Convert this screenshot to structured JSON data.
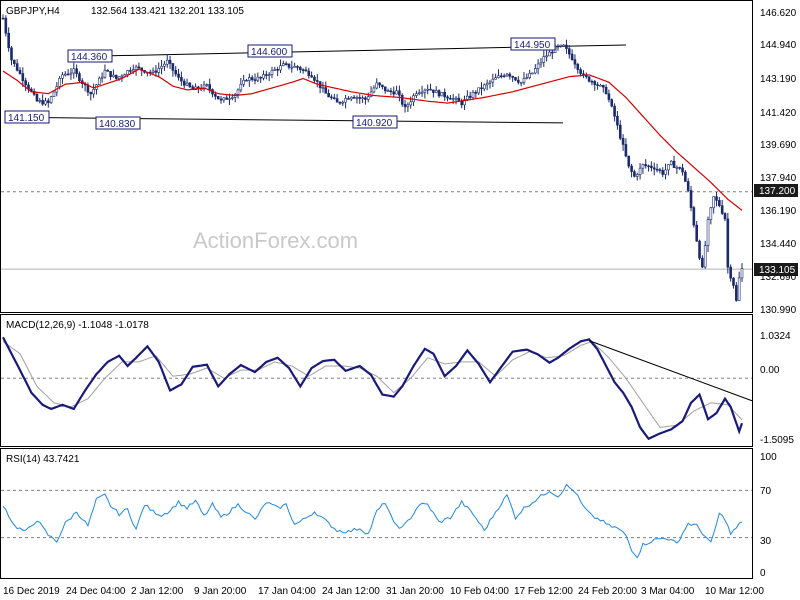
{
  "chart_data": {
    "type": "candlestick",
    "symbol_header": "GBPJPY,H4",
    "ohlc_header": "132.564 133.421 132.201 133.105",
    "watermark": "ActionForex.com",
    "colors": {
      "candle": "#1a2a6c",
      "ma": "#d60000",
      "macd": "#1a1a7a",
      "signal": "#a0a0a0",
      "rsi": "#1e88e5",
      "grid": "#808080",
      "axis": "#000000",
      "annot_fill": "#ffffff"
    },
    "x_ticks": [
      "16 Dec 2019",
      "24 Dec 04:00",
      "2 Jan 12:00",
      "9 Jan 20:00",
      "17 Jan 04:00",
      "24 Jan 12:00",
      "31 Jan 20:00",
      "10 Feb 04:00",
      "17 Feb 12:00",
      "24 Feb 20:00",
      "3 Mar 04:00",
      "10 Mar 12:00"
    ],
    "price_panel": {
      "ylim": [
        130.99,
        146.62
      ],
      "y_ticks": [
        "146.620",
        "144.940",
        "143.190",
        "141.420",
        "139.690",
        "137.940",
        "136.190",
        "134.440",
        "132.690",
        "130.990"
      ],
      "current_price": "133.105",
      "level_line": "137.200",
      "annotations": [
        "144.360",
        "144.600",
        "144.950",
        "141.150",
        "140.830",
        "140.920"
      ],
      "ma_anchor": [
        [
          0,
          143.6
        ],
        [
          5,
          143.1
        ],
        [
          10,
          142.5
        ],
        [
          16,
          142.4
        ],
        [
          22,
          142.9
        ],
        [
          28,
          143.0
        ],
        [
          32,
          142.7
        ],
        [
          36,
          142.9
        ],
        [
          42,
          143.2
        ],
        [
          48,
          143.7
        ],
        [
          55,
          143.3
        ],
        [
          60,
          142.8
        ],
        [
          65,
          142.6
        ],
        [
          71,
          142.7
        ],
        [
          76,
          142.4
        ],
        [
          82,
          142.3
        ],
        [
          88,
          142.4
        ],
        [
          95,
          142.7
        ],
        [
          102,
          143.0
        ],
        [
          106,
          143.2
        ],
        [
          111,
          142.9
        ],
        [
          117,
          142.7
        ],
        [
          123,
          142.5
        ],
        [
          131,
          142.3
        ],
        [
          140,
          142.2
        ],
        [
          150,
          142.0
        ],
        [
          157,
          141.9
        ],
        [
          170,
          142.2
        ],
        [
          180,
          142.5
        ],
        [
          190,
          142.9
        ],
        [
          200,
          143.3
        ],
        [
          207,
          143.4
        ],
        [
          214,
          143.0
        ],
        [
          220,
          142.2
        ],
        [
          226,
          141.2
        ],
        [
          232,
          140.2
        ],
        [
          238,
          139.3
        ],
        [
          244,
          138.5
        ],
        [
          250,
          137.7
        ],
        [
          256,
          136.8
        ],
        [
          262,
          136.1
        ]
      ],
      "close_anchor": [
        [
          0,
          146.4
        ],
        [
          3,
          144.2
        ],
        [
          7,
          143.2
        ],
        [
          12,
          142.0
        ],
        [
          16,
          141.9
        ],
        [
          21,
          143.4
        ],
        [
          25,
          143.6
        ],
        [
          31,
          142.4
        ],
        [
          36,
          143.6
        ],
        [
          40,
          143.2
        ],
        [
          46,
          143.8
        ],
        [
          53,
          143.5
        ],
        [
          58,
          144.1
        ],
        [
          62,
          143.2
        ],
        [
          67,
          142.6
        ],
        [
          72,
          142.8
        ],
        [
          77,
          142.0
        ],
        [
          82,
          142.4
        ],
        [
          86,
          143.2
        ],
        [
          91,
          143.2
        ],
        [
          94,
          143.5
        ],
        [
          99,
          143.9
        ],
        [
          104,
          143.8
        ],
        [
          109,
          143.4
        ],
        [
          114,
          142.4
        ],
        [
          118,
          141.9
        ],
        [
          123,
          142.3
        ],
        [
          128,
          142.1
        ],
        [
          132,
          142.9
        ],
        [
          136,
          142.5
        ],
        [
          139,
          142.5
        ],
        [
          142,
          141.6
        ],
        [
          146,
          142.5
        ],
        [
          150,
          142.7
        ],
        [
          154,
          142.4
        ],
        [
          158,
          142.2
        ],
        [
          162,
          141.9
        ],
        [
          166,
          142.4
        ],
        [
          170,
          142.8
        ],
        [
          174,
          143.2
        ],
        [
          178,
          143.5
        ],
        [
          183,
          143.0
        ],
        [
          187,
          143.5
        ],
        [
          191,
          144.3
        ],
        [
          195,
          144.8
        ],
        [
          198,
          144.9
        ],
        [
          201,
          144.3
        ],
        [
          205,
          143.3
        ],
        [
          209,
          143.0
        ],
        [
          213,
          142.5
        ],
        [
          216,
          141.2
        ],
        [
          219,
          139.6
        ],
        [
          221,
          138.5
        ],
        [
          223,
          138.0
        ],
        [
          226,
          138.6
        ],
        [
          230,
          138.5
        ],
        [
          233,
          138.2
        ],
        [
          236,
          138.7
        ],
        [
          240,
          138.3
        ],
        [
          242,
          137.2
        ],
        [
          244,
          135.5
        ],
        [
          246,
          133.8
        ],
        [
          247,
          133.1
        ],
        [
          249,
          135.6
        ],
        [
          251,
          136.9
        ],
        [
          253,
          136.5
        ],
        [
          255,
          135.8
        ],
        [
          256,
          133.2
        ],
        [
          258,
          132.3
        ],
        [
          259,
          131.4
        ],
        [
          260,
          132.6
        ],
        [
          261,
          133.1
        ]
      ]
    },
    "macd_panel": {
      "label": "MACD(12,26,9) -1.1048 -1.0178",
      "ylim": [
        -1.5095,
        1.0324
      ],
      "y_ticks": [
        "1.0324",
        "0.00",
        "-1.5095"
      ],
      "main_anchor": [
        [
          0,
          1.0
        ],
        [
          6,
          0.2
        ],
        [
          10,
          -0.35
        ],
        [
          14,
          -0.65
        ],
        [
          17,
          -0.75
        ],
        [
          21,
          -0.65
        ],
        [
          25,
          -0.75
        ],
        [
          29,
          -0.3
        ],
        [
          33,
          0.1
        ],
        [
          37,
          0.4
        ],
        [
          41,
          0.55
        ],
        [
          44,
          0.3
        ],
        [
          47,
          0.5
        ],
        [
          51,
          0.78
        ],
        [
          55,
          0.4
        ],
        [
          59,
          -0.3
        ],
        [
          63,
          -0.15
        ],
        [
          67,
          0.28
        ],
        [
          72,
          0.33
        ],
        [
          76,
          -0.2
        ],
        [
          80,
          0.1
        ],
        [
          84,
          0.32
        ],
        [
          89,
          0.15
        ],
        [
          93,
          0.4
        ],
        [
          97,
          0.5
        ],
        [
          101,
          0.25
        ],
        [
          105,
          -0.2
        ],
        [
          109,
          0.25
        ],
        [
          113,
          0.42
        ],
        [
          117,
          0.45
        ],
        [
          121,
          0.18
        ],
        [
          126,
          0.3
        ],
        [
          130,
          0.08
        ],
        [
          134,
          -0.4
        ],
        [
          138,
          -0.45
        ],
        [
          141,
          -0.2
        ],
        [
          145,
          0.3
        ],
        [
          149,
          0.72
        ],
        [
          152,
          0.6
        ],
        [
          156,
          0.05
        ],
        [
          160,
          0.3
        ],
        [
          164,
          0.68
        ],
        [
          168,
          0.35
        ],
        [
          172,
          -0.1
        ],
        [
          176,
          0.28
        ],
        [
          180,
          0.65
        ],
        [
          185,
          0.7
        ],
        [
          189,
          0.58
        ],
        [
          193,
          0.38
        ],
        [
          196,
          0.5
        ],
        [
          200,
          0.72
        ],
        [
          204,
          0.9
        ],
        [
          207,
          0.95
        ],
        [
          210,
          0.7
        ],
        [
          213,
          0.3
        ],
        [
          216,
          -0.1
        ],
        [
          219,
          -0.35
        ],
        [
          222,
          -0.7
        ],
        [
          225,
          -1.2
        ],
        [
          228,
          -1.48
        ],
        [
          232,
          -1.35
        ],
        [
          236,
          -1.25
        ],
        [
          240,
          -1.05
        ],
        [
          243,
          -0.6
        ],
        [
          246,
          -0.4
        ],
        [
          249,
          -1.0
        ],
        [
          252,
          -0.85
        ],
        [
          255,
          -0.5
        ],
        [
          257,
          -0.7
        ],
        [
          259,
          -1.1
        ],
        [
          260,
          -1.3
        ],
        [
          261,
          -1.1
        ]
      ],
      "signal_anchor": [
        [
          0,
          0.9
        ],
        [
          6,
          0.6
        ],
        [
          12,
          -0.2
        ],
        [
          18,
          -0.6
        ],
        [
          24,
          -0.7
        ],
        [
          30,
          -0.5
        ],
        [
          36,
          0.0
        ],
        [
          42,
          0.4
        ],
        [
          48,
          0.4
        ],
        [
          54,
          0.55
        ],
        [
          60,
          0.05
        ],
        [
          66,
          0.1
        ],
        [
          72,
          0.25
        ],
        [
          78,
          0.0
        ],
        [
          84,
          0.2
        ],
        [
          90,
          0.2
        ],
        [
          96,
          0.4
        ],
        [
          102,
          0.3
        ],
        [
          108,
          0.05
        ],
        [
          114,
          0.3
        ],
        [
          120,
          0.3
        ],
        [
          126,
          0.25
        ],
        [
          132,
          0.05
        ],
        [
          138,
          -0.35
        ],
        [
          144,
          0.0
        ],
        [
          150,
          0.5
        ],
        [
          156,
          0.35
        ],
        [
          162,
          0.4
        ],
        [
          168,
          0.4
        ],
        [
          174,
          0.05
        ],
        [
          180,
          0.45
        ],
        [
          186,
          0.65
        ],
        [
          192,
          0.5
        ],
        [
          198,
          0.55
        ],
        [
          204,
          0.8
        ],
        [
          208,
          0.9
        ],
        [
          214,
          0.5
        ],
        [
          220,
          0.0
        ],
        [
          226,
          -0.6
        ],
        [
          232,
          -1.2
        ],
        [
          238,
          -1.15
        ],
        [
          244,
          -0.8
        ],
        [
          250,
          -0.6
        ],
        [
          256,
          -0.65
        ],
        [
          261,
          -1.02
        ]
      ],
      "trendline": "from 0.92 at 17 Feb peak to -0.55 at right edge"
    },
    "rsi_panel": {
      "label": "RSI(14) 43.7421",
      "ylim": [
        0,
        100
      ],
      "y_ticks": [
        "100",
        "70",
        "30",
        "0"
      ],
      "anchor": [
        [
          0,
          58
        ],
        [
          4,
          40
        ],
        [
          8,
          35
        ],
        [
          12,
          45
        ],
        [
          16,
          32
        ],
        [
          19,
          27
        ],
        [
          22,
          42
        ],
        [
          26,
          52
        ],
        [
          30,
          40
        ],
        [
          33,
          62
        ],
        [
          36,
          66
        ],
        [
          38,
          57
        ],
        [
          41,
          50
        ],
        [
          44,
          54
        ],
        [
          47,
          37
        ],
        [
          50,
          58
        ],
        [
          53,
          52
        ],
        [
          56,
          49
        ],
        [
          59,
          53
        ],
        [
          62,
          60
        ],
        [
          65,
          55
        ],
        [
          68,
          61
        ],
        [
          71,
          48
        ],
        [
          74,
          58
        ],
        [
          77,
          47
        ],
        [
          80,
          52
        ],
        [
          83,
          58
        ],
        [
          86,
          52
        ],
        [
          89,
          45
        ],
        [
          93,
          60
        ],
        [
          97,
          55
        ],
        [
          100,
          58
        ],
        [
          103,
          41
        ],
        [
          106,
          45
        ],
        [
          110,
          52
        ],
        [
          114,
          44
        ],
        [
          118,
          36
        ],
        [
          122,
          35
        ],
        [
          126,
          38
        ],
        [
          129,
          33
        ],
        [
          132,
          52
        ],
        [
          135,
          60
        ],
        [
          138,
          42
        ],
        [
          141,
          38
        ],
        [
          144,
          47
        ],
        [
          147,
          58
        ],
        [
          150,
          58
        ],
        [
          154,
          43
        ],
        [
          158,
          47
        ],
        [
          162,
          60
        ],
        [
          166,
          50
        ],
        [
          170,
          36
        ],
        [
          174,
          52
        ],
        [
          178,
          66
        ],
        [
          181,
          47
        ],
        [
          184,
          55
        ],
        [
          187,
          60
        ],
        [
          190,
          65
        ],
        [
          193,
          70
        ],
        [
          196,
          65
        ],
        [
          199,
          74
        ],
        [
          202,
          69
        ],
        [
          205,
          56
        ],
        [
          208,
          48
        ],
        [
          211,
          45
        ],
        [
          214,
          40
        ],
        [
          217,
          38
        ],
        [
          220,
          32
        ],
        [
          222,
          20
        ],
        [
          224,
          14
        ],
        [
          226,
          24
        ],
        [
          230,
          28
        ],
        [
          234,
          30
        ],
        [
          238,
          25
        ],
        [
          242,
          42
        ],
        [
          245,
          40
        ],
        [
          248,
          31
        ],
        [
          250,
          25
        ],
        [
          253,
          50
        ],
        [
          255,
          46
        ],
        [
          257,
          33
        ],
        [
          259,
          38
        ],
        [
          261,
          44
        ]
      ]
    }
  }
}
